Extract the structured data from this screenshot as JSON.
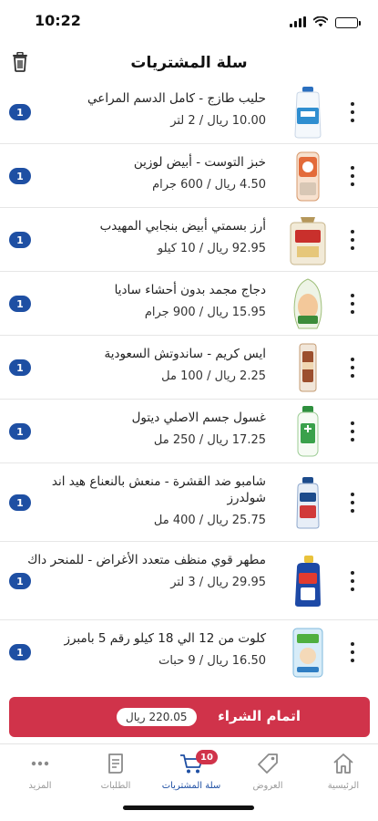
{
  "status_bar": {
    "time": "10:22"
  },
  "header": {
    "title": "سلة المشتريات"
  },
  "cart": {
    "items": [
      {
        "name": "حليب طازج - كامل الدسم المراعي",
        "price": "10.00",
        "currency": "ريال",
        "unit": "/ 2 لتر",
        "qty": "1",
        "thumb_color": "#e8f2fb"
      },
      {
        "name": "خبز التوست - أبيض  لوزين",
        "price": "4.50",
        "currency": "ريال",
        "unit": "/ 600 جرام",
        "qty": "1",
        "thumb_color": "#f3d9c6"
      },
      {
        "name": "أرز بسمتي أبيض بنجابي المهيدب",
        "price": "92.95",
        "currency": "ريال",
        "unit": "/ 10 كيلو",
        "qty": "1",
        "thumb_color": "#efe6d2"
      },
      {
        "name": "دجاج مجمد بدون أحشاء ساديا",
        "price": "15.95",
        "currency": "ريال",
        "unit": "/ 900 جرام",
        "qty": "1",
        "thumb_color": "#e9f0dd"
      },
      {
        "name": "ايس كريم - ساندوتش السعودية",
        "price": "2.25",
        "currency": "ريال",
        "unit": "/ 100 مل",
        "qty": "1",
        "thumb_color": "#e7c9b0"
      },
      {
        "name": "غسول جسم الاصلي  ديتول",
        "price": "17.25",
        "currency": "ريال",
        "unit": "/ 250 مل",
        "qty": "1",
        "thumb_color": "#dff0da"
      },
      {
        "name": "شامبو ضد القشرة - منعش بالنعناع هيد اند شولدرز",
        "price": "25.75",
        "currency": "ريال",
        "unit": "/ 400 مل",
        "qty": "1",
        "thumb_color": "#d9e4f0"
      },
      {
        "name": "مطهر قوي منظف متعدد الأغراض - للمنحر داك",
        "price": "29.95",
        "currency": "ريال",
        "unit": "/ 3 لتر",
        "qty": "1",
        "thumb_color": "#dbe3f3"
      },
      {
        "name": "كلوت من 12 الي 18 كيلو رقم 5 بامبرز",
        "price": "16.50",
        "currency": "ريال",
        "unit": "/ 9 حبات",
        "qty": "1",
        "thumb_color": "#dcecf6"
      }
    ]
  },
  "checkout": {
    "label": "اتمام الشراء",
    "total": "220.05",
    "currency": "ريال"
  },
  "tab_bar": {
    "tabs": [
      {
        "label": "الرئيسية",
        "icon": "home-icon"
      },
      {
        "label": "العروض",
        "icon": "tag-icon"
      },
      {
        "label": "سلة المشتريات",
        "icon": "cart-icon",
        "badge": "10"
      },
      {
        "label": "الطلبات",
        "icon": "receipt-icon"
      },
      {
        "label": "المزيد",
        "icon": "more-icon"
      }
    ]
  },
  "colors": {
    "accent": "#1e4fa3",
    "checkout": "#d0334a"
  }
}
